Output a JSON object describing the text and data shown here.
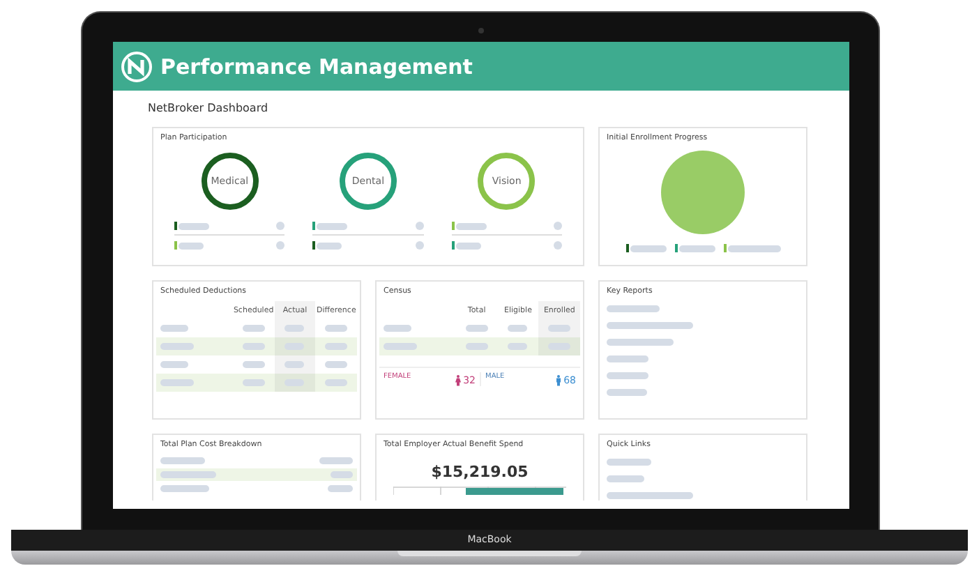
{
  "header": {
    "title": "Performance Management"
  },
  "page_title": "NetBroker Dashboard",
  "plan_participation": {
    "title": "Plan Participation",
    "plans": [
      {
        "label": "Medical",
        "color": "#1b5e20",
        "legend": [
          {
            "color": "#1b5e20"
          },
          {
            "color": "#8bc34a"
          }
        ]
      },
      {
        "label": "Dental",
        "color": "#26a17a",
        "legend": [
          {
            "color": "#26a17a"
          },
          {
            "color": "#1b5e20"
          }
        ]
      },
      {
        "label": "Vision",
        "color": "#8bc34a",
        "legend": [
          {
            "color": "#8bc34a"
          },
          {
            "color": "#26a17a"
          }
        ]
      }
    ]
  },
  "enrollment": {
    "title": "Initial Enrollment Progress",
    "legend": [
      {
        "color": "#1b5e20"
      },
      {
        "color": "#26a17a"
      },
      {
        "color": "#8bc34a"
      }
    ]
  },
  "deductions": {
    "title": "Scheduled Deductions",
    "columns": [
      {
        "label": "Scheduled",
        "shaded": false
      },
      {
        "label": "Actual",
        "shaded": true
      },
      {
        "label": "Difference",
        "shaded": false
      }
    ],
    "rows": [
      {
        "highlighted": false
      },
      {
        "highlighted": true
      },
      {
        "highlighted": false
      },
      {
        "highlighted": true
      }
    ]
  },
  "census": {
    "title": "Census",
    "columns": [
      {
        "label": "Total",
        "shaded": false
      },
      {
        "label": "Eligible",
        "shaded": false
      },
      {
        "label": "Enrolled",
        "shaded": true
      }
    ],
    "rows": [
      {
        "highlighted": false
      },
      {
        "highlighted": true
      }
    ],
    "female": {
      "label": "FEMALE",
      "count": "32"
    },
    "male": {
      "label": "MALE",
      "count": "68"
    }
  },
  "key_reports": {
    "title": "Key Reports"
  },
  "cost_breakdown": {
    "title": "Total Plan Cost Breakdown"
  },
  "benefit_spend": {
    "title": "Total Employer Actual Benefit Spend",
    "amount": "$15,219.05"
  },
  "quick_links": {
    "title": "Quick Links"
  },
  "device": {
    "label": "MacBook"
  }
}
